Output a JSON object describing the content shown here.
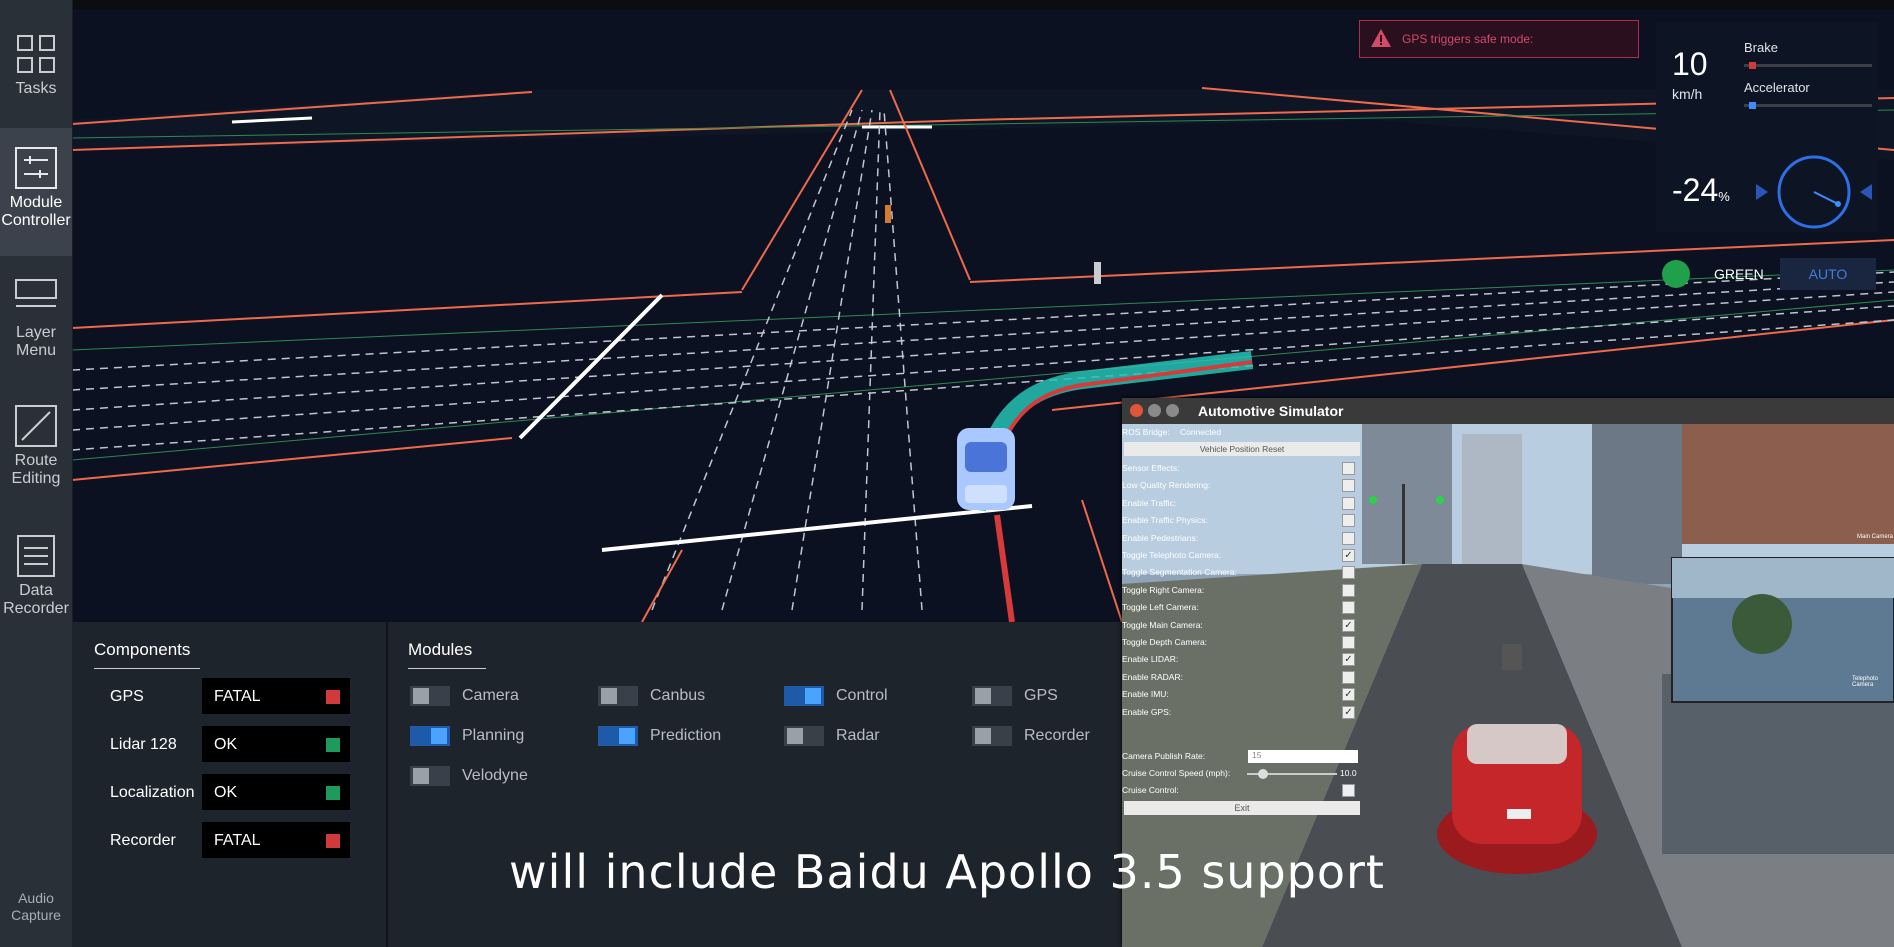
{
  "sidebar": {
    "items": [
      {
        "label_1": "Tasks",
        "label_2": "",
        "icon": "tasks-icon"
      },
      {
        "label_1": "Module",
        "label_2": "Controller",
        "icon": "sliders-icon"
      },
      {
        "label_1": "Layer",
        "label_2": "Menu",
        "icon": "layer-icon"
      },
      {
        "label_1": "Route",
        "label_2": "Editing",
        "icon": "route-icon"
      },
      {
        "label_1": "Data",
        "label_2": "Recorder",
        "icon": "recorder-icon"
      }
    ],
    "audio_1": "Audio",
    "audio_2": "Capture"
  },
  "alert": {
    "text": "GPS triggers safe mode:",
    "icon": "warning-icon"
  },
  "dashboard": {
    "speed": "10",
    "speed_unit": "km/h",
    "brake_label": "Brake",
    "accelerator_label": "Accelerator",
    "brake_level": 0.04,
    "accelerator_level": 0.04,
    "steering": "-24",
    "steering_unit": "%",
    "traffic_light": "GREEN",
    "mode": "AUTO",
    "colors": {
      "brake": "#d03a3a",
      "accelerator": "#3f8cff",
      "green": "#20a04a"
    }
  },
  "components": {
    "title": "Components",
    "rows": [
      {
        "name": "GPS",
        "status": "FATAL",
        "color": "#d13a3a"
      },
      {
        "name": "Lidar 128",
        "status": "OK",
        "color": "#1e9a5c"
      },
      {
        "name": "Localization",
        "status": "OK",
        "color": "#1e9a5c"
      },
      {
        "name": "Recorder",
        "status": "FATAL",
        "color": "#d13a3a"
      }
    ]
  },
  "modules": {
    "title": "Modules",
    "items": [
      {
        "label": "Camera",
        "on": false
      },
      {
        "label": "Canbus",
        "on": false
      },
      {
        "label": "Control",
        "on": true
      },
      {
        "label": "GPS",
        "on": false
      },
      {
        "label": "Planning",
        "on": true
      },
      {
        "label": "Prediction",
        "on": true
      },
      {
        "label": "Radar",
        "on": false
      },
      {
        "label": "Recorder",
        "on": false
      },
      {
        "label": "Velodyne",
        "on": false
      }
    ]
  },
  "simulator": {
    "title": "Automotive Simulator",
    "ros_label": "ROS Bridge:",
    "ros_status": "Connected",
    "reset_button": "Vehicle Position Reset",
    "settings": [
      {
        "label": "Sensor Effects:",
        "checked": false
      },
      {
        "label": "Low Quality Rendering:",
        "checked": false
      },
      {
        "label": "Enable Traffic:",
        "checked": false
      },
      {
        "label": "Enable Traffic Physics:",
        "checked": false
      },
      {
        "label": "Enable Pedestrians:",
        "checked": false
      },
      {
        "label": "Toggle Telephoto Camera:",
        "checked": true
      },
      {
        "label": "Toggle Segmentation Camera:",
        "checked": false
      },
      {
        "label": "Toggle Right Camera:",
        "checked": false
      },
      {
        "label": "Toggle Left Camera:",
        "checked": false
      },
      {
        "label": "Toggle Main Camera:",
        "checked": true
      },
      {
        "label": "Toggle Depth Camera:",
        "checked": false
      },
      {
        "label": "Enable LIDAR:",
        "checked": true
      },
      {
        "label": "Enable RADAR:",
        "checked": false
      },
      {
        "label": "Enable IMU:",
        "checked": true
      },
      {
        "label": "Enable GPS:",
        "checked": true
      }
    ],
    "publish_rate_label": "Camera Publish Rate:",
    "publish_rate_value": "15",
    "cruise_speed_label": "Cruise Control Speed (mph):",
    "cruise_speed_value": "10.0",
    "cruise_control_label": "Cruise Control:",
    "exit_button": "Exit",
    "inset_label_1": "Main Camera",
    "inset_label_2": "Telephoto Camera"
  },
  "subtitle": "will include Baidu Apollo 3.5 support"
}
